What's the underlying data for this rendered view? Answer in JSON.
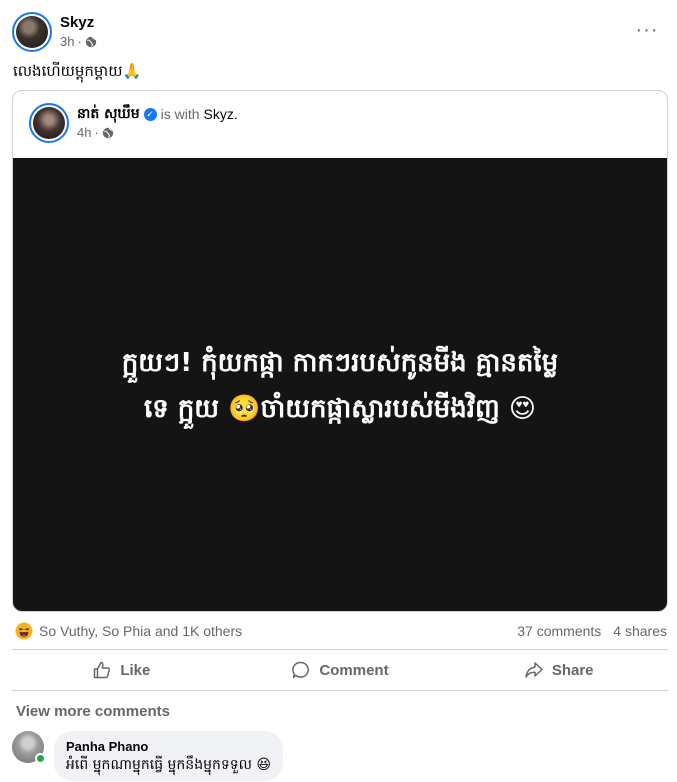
{
  "post": {
    "author": "Skyz",
    "time": "3h",
    "time_separator": "·",
    "more_icon": "···",
    "caption": "លេងហើយម្តុកម្តាយ🙏"
  },
  "shared_post": {
    "author": "នាត់ សុឃឹម",
    "verified_icon": "✓",
    "with_text": "is with",
    "with_name": "Skyz.",
    "time": "4h",
    "time_separator": "·",
    "image_text_line1": "ក្អួយៗ! កុំយកផ្កា កាកៗរបស់កូនមីង គ្មានតម្លៃ",
    "image_text_line2": "ទេ ក្អួយ 🥺ចាំយកផ្កាស្លារបស់មីងវិញ 😍"
  },
  "reactions": {
    "summary": "So Vuthy, So Phia and 1K others",
    "comments": "37 comments",
    "shares": "4 shares"
  },
  "actions": {
    "like": "Like",
    "comment": "Comment",
    "share": "Share"
  },
  "comments": {
    "view_more": "View more comments",
    "items": [
      {
        "name": "Panha Phano",
        "text": "អំពើ ម្នុកណាម្នុកធ្វើ ម្នុកនឹងម្នុកទទួល 😆"
      }
    ]
  },
  "colors": {
    "accent": "#1877f2",
    "muted": "#65676b",
    "online": "#31a24c"
  }
}
